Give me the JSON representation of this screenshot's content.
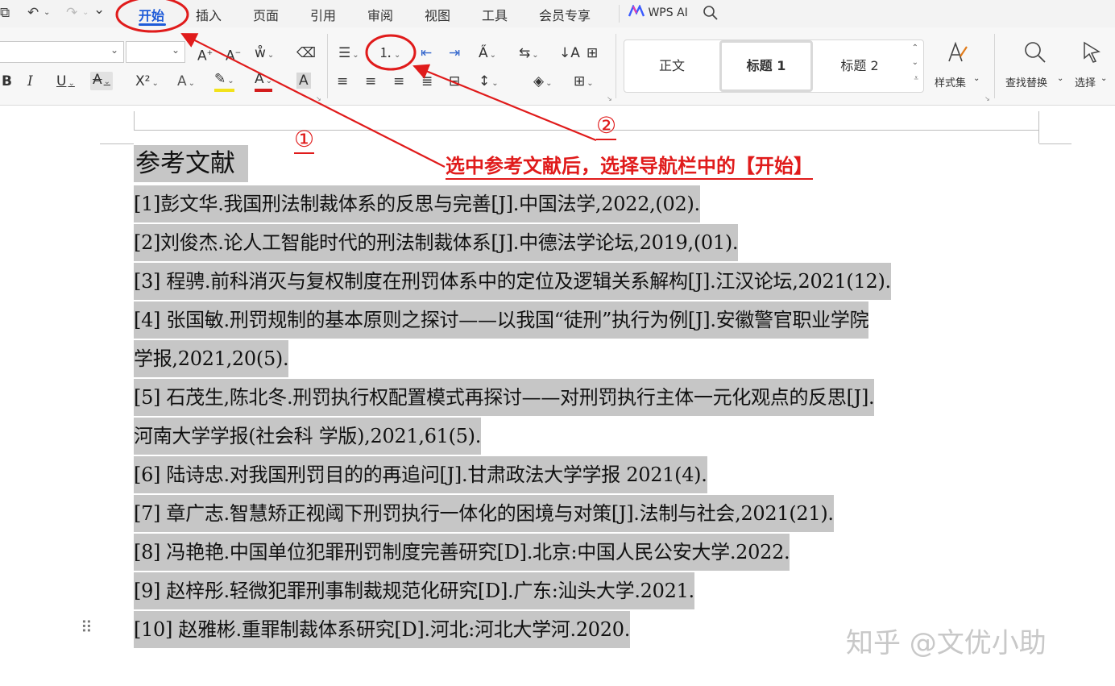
{
  "quick_access": {
    "print_preview_icon": "⧉",
    "undo_icon": "↶",
    "redo_icon": "↷",
    "more_icon": "⌄"
  },
  "menu": {
    "tabs": [
      "开始",
      "插入",
      "页面",
      "引用",
      "审阅",
      "视图",
      "工具",
      "会员专享"
    ],
    "wps_ai": "WPS AI"
  },
  "ribbon": {
    "font_name": "",
    "font_size": "",
    "styles": {
      "normal": "正文",
      "heading1": "标题 1",
      "heading2": "标题 2"
    },
    "style_set": "样式集",
    "find_replace": "查找替换",
    "select": "选择"
  },
  "document": {
    "heading": "参考文献",
    "refs": [
      "[1]彭文华.我国刑法制裁体系的反思与完善[J].中国法学,2022,(02).",
      "[2]刘俊杰.论人工智能时代的刑法制裁体系[J].中德法学论坛,2019,(01).",
      "[3]  程骋.前科消灭与复权制度在刑罚体系中的定位及逻辑关系解构[J].江汉论坛,2021(12).",
      "[4]  张国敏.刑罚规制的基本原则之探讨——以我国“徒刑”执行为例[J].安徽警官职业学院",
      "学报,2021,20(5).",
      "[5]  石茂生,陈北冬.刑罚执行权配置模式再探讨——对刑罚执行主体一元化观点的反思[J].",
      "河南大学学报(社会科  学版),2021,61(5).",
      "[6]  陆诗忠.对我国刑罚目的的再追问[J].甘肃政法大学学报 2021(4).",
      "[7]  章广志.智慧矫正视阈下刑罚执行一体化的困境与对策[J].法制与社会,2021(21).",
      "[8]  冯艳艳.中国单位犯罪刑罚制度完善研究[D].北京:中国人民公安大学.2022.",
      "[9]  赵梓彤.轻微犯罪刑事制裁规范化研究[D].广东:汕头大学.2021.",
      "[10]  赵雅彬.重罪制裁体系研究[D].河北:河北大学河.2020."
    ]
  },
  "annotations": {
    "circle1": "①",
    "circle2": "②",
    "instruction": "选中参考文献后，选择导航栏中的【开始】",
    "color": "#e01b1b"
  },
  "watermark": "知乎 @文优小助"
}
